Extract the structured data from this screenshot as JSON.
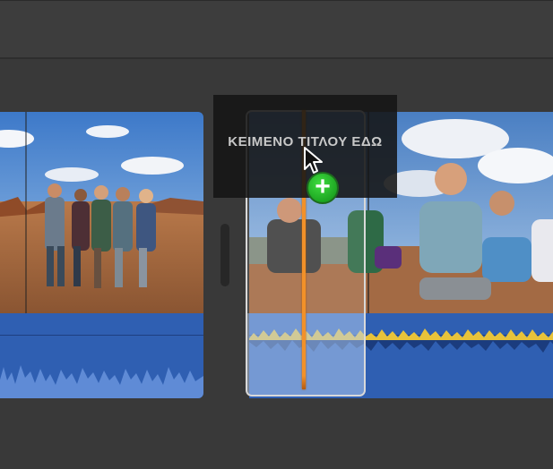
{
  "title_overlay": {
    "text": "ΚΕΙΜΕΝΟ ΤΙΤΛΟΥ ΕΔΩ"
  },
  "colors": {
    "audio_track": "#2f5fb2",
    "playhead": "#f29129",
    "add_badge": "#1fb52a"
  },
  "icons": {
    "add": "plus-icon",
    "cursor": "arrow-cursor-icon"
  }
}
